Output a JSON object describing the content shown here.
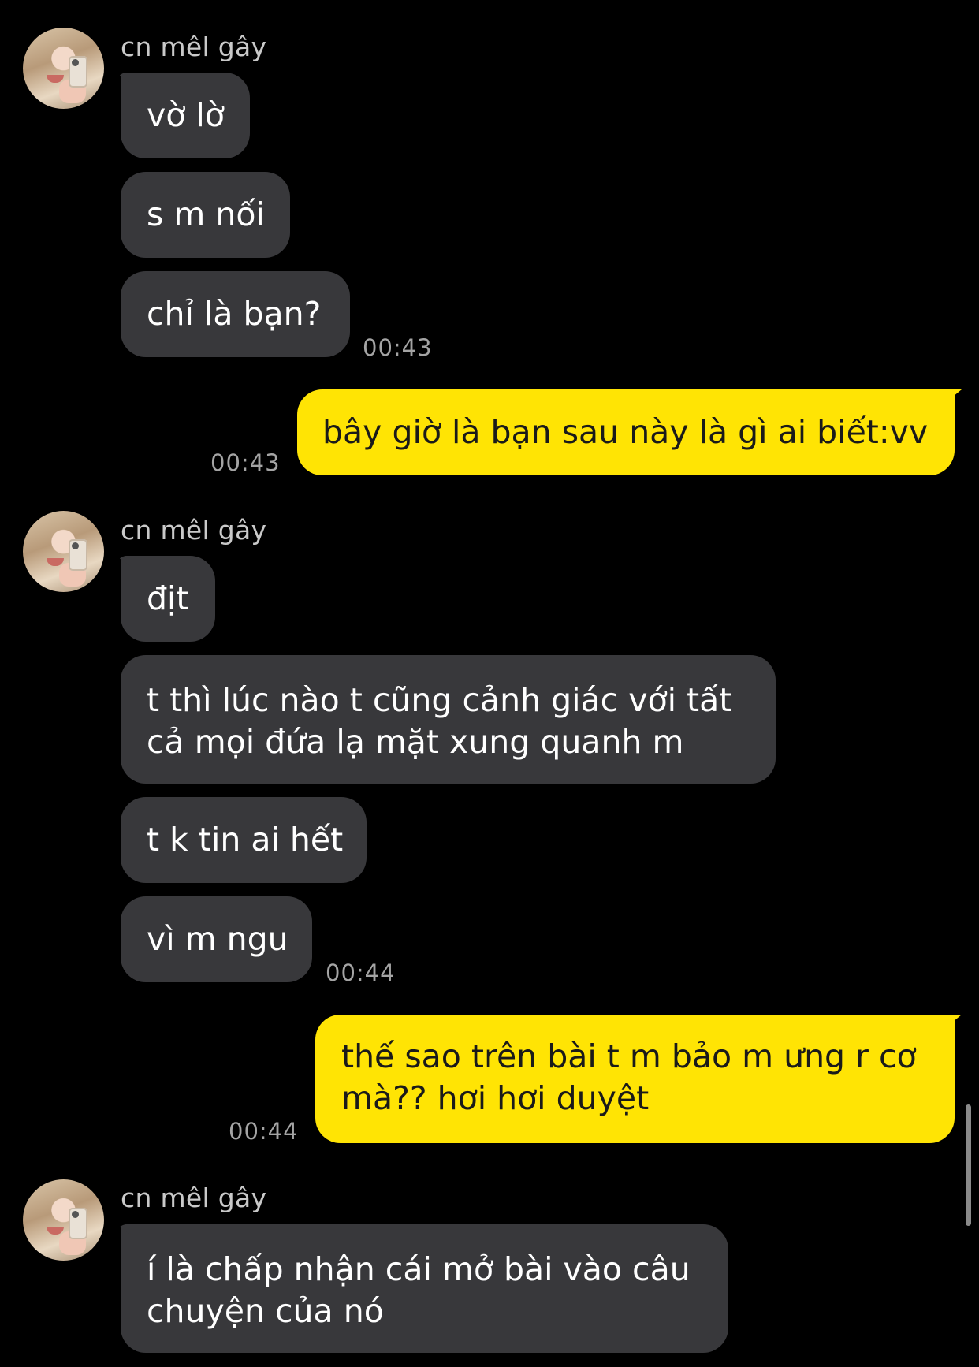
{
  "contact": {
    "name": "cn mêl gây",
    "avatar_icon": "profile-photo"
  },
  "colors": {
    "background": "#000000",
    "incoming_bubble": "#38383b",
    "outgoing_bubble": "#ffe404",
    "timestamp": "#a4a4a4"
  },
  "messages": [
    {
      "from": "them",
      "text": "vờ lờ"
    },
    {
      "from": "them",
      "text": "s m nối"
    },
    {
      "from": "them",
      "text": "chỉ là bạn?",
      "time": "00:43"
    },
    {
      "from": "me",
      "text": "bây giờ là bạn sau này là gì ai biết:vv",
      "time": "00:43"
    },
    {
      "from": "them",
      "text": "địt"
    },
    {
      "from": "them",
      "lines": [
        "t thì lúc nào t cũng cảnh giác với tất",
        "cả mọi đứa lạ mặt xung quanh m"
      ]
    },
    {
      "from": "them",
      "text": "t k tin ai hết"
    },
    {
      "from": "them",
      "text": "vì m ngu",
      "time": "00:44"
    },
    {
      "from": "me",
      "lines": [
        "thế sao trên bài t m bảo m ưng r cơ",
        "mà?? hơi hơi duyệt"
      ],
      "time": "00:44"
    },
    {
      "from": "them",
      "lines": [
        "í là chấp nhận cái mở bài vào câu",
        "chuyện của nó"
      ]
    }
  ]
}
